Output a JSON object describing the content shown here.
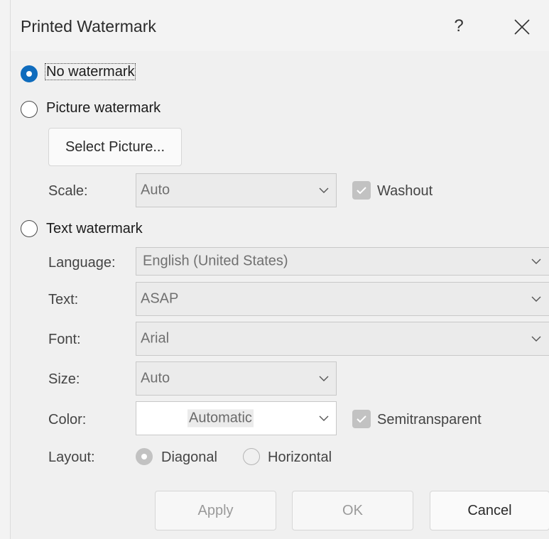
{
  "window": {
    "title": "Printed Watermark",
    "help_label": "?"
  },
  "options": {
    "no_watermark": {
      "label": "No watermark",
      "checked": true
    },
    "picture_watermark": {
      "label": "Picture watermark",
      "checked": false
    },
    "text_watermark": {
      "label": "Text watermark",
      "checked": false
    }
  },
  "picture": {
    "select_button": "Select Picture...",
    "scale_label": "Scale:",
    "scale_value": "Auto",
    "washout_label": "Washout",
    "washout_checked": true
  },
  "text": {
    "language_label": "Language:",
    "language_value": "English (United States)",
    "text_label": "Text:",
    "text_value": "ASAP",
    "font_label": "Font:",
    "font_value": "Arial",
    "size_label": "Size:",
    "size_value": "Auto",
    "color_label": "Color:",
    "color_value": "Automatic",
    "semitransparent_label": "Semitransparent",
    "semitransparent_checked": true,
    "layout_label": "Layout:",
    "layout_diagonal": "Diagonal",
    "layout_horizontal": "Horizontal",
    "layout_selected": "Diagonal"
  },
  "buttons": {
    "apply": "Apply",
    "ok": "OK",
    "cancel": "Cancel"
  },
  "colors": {
    "accent": "#0f6cbd",
    "disabled_fill": "#c2c2c2"
  }
}
